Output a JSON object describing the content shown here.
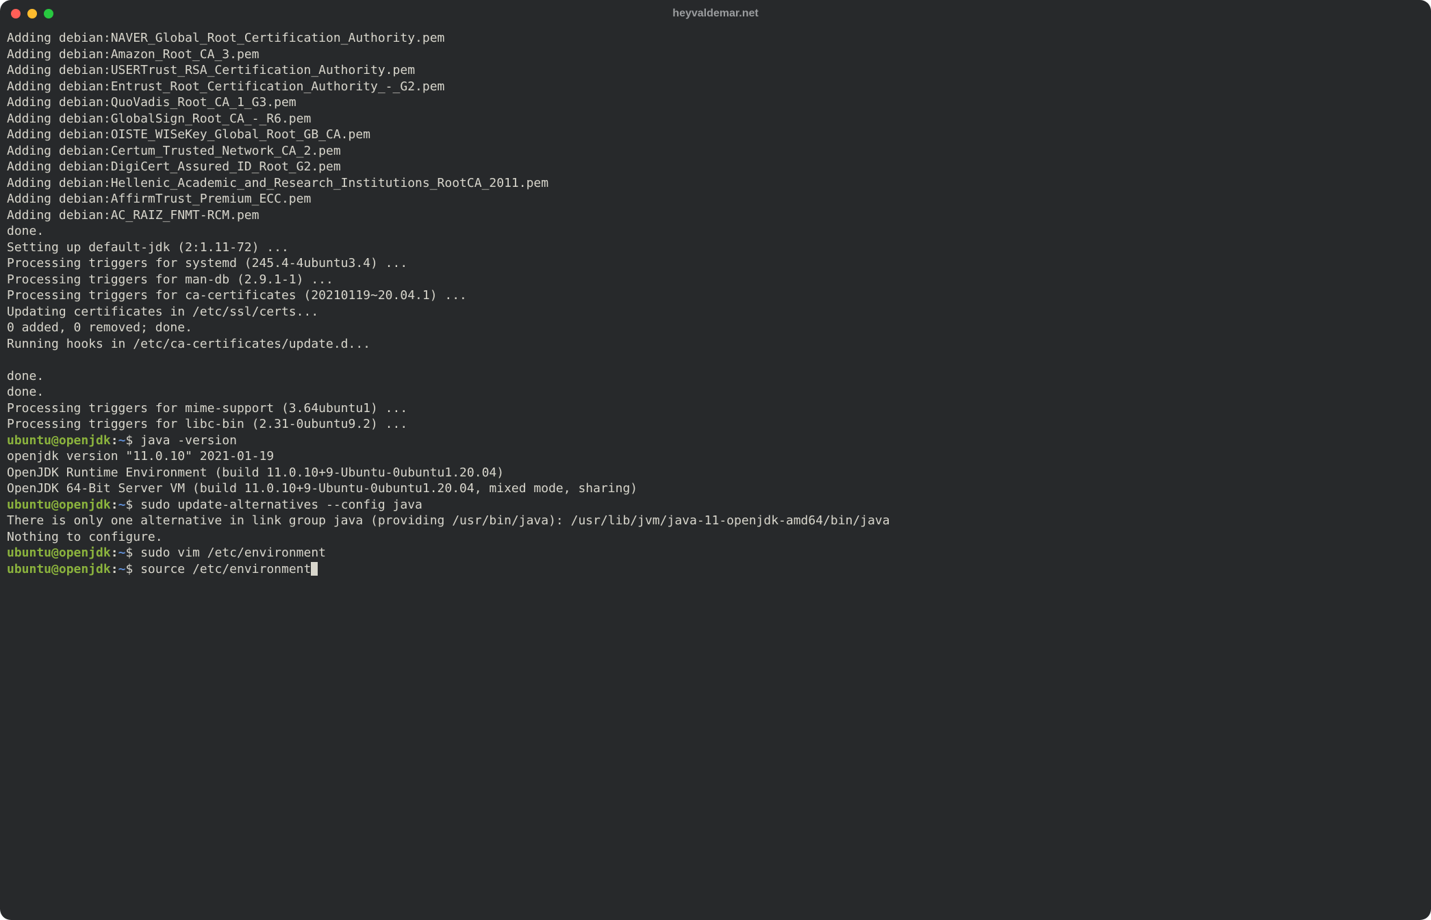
{
  "window": {
    "title": "heyvaldemar.net"
  },
  "colors": {
    "bg": "#27292b",
    "fg": "#d8d6cc",
    "prompt_user": "#8bb33d",
    "prompt_path": "#5f8dd3"
  },
  "prompt": {
    "user_host": "ubuntu@openjdk",
    "colon": ":",
    "path": "~",
    "symbol": "$"
  },
  "output_lines": [
    "Adding debian:NAVER_Global_Root_Certification_Authority.pem",
    "Adding debian:Amazon_Root_CA_3.pem",
    "Adding debian:USERTrust_RSA_Certification_Authority.pem",
    "Adding debian:Entrust_Root_Certification_Authority_-_G2.pem",
    "Adding debian:QuoVadis_Root_CA_1_G3.pem",
    "Adding debian:GlobalSign_Root_CA_-_R6.pem",
    "Adding debian:OISTE_WISeKey_Global_Root_GB_CA.pem",
    "Adding debian:Certum_Trusted_Network_CA_2.pem",
    "Adding debian:DigiCert_Assured_ID_Root_G2.pem",
    "Adding debian:Hellenic_Academic_and_Research_Institutions_RootCA_2011.pem",
    "Adding debian:AffirmTrust_Premium_ECC.pem",
    "Adding debian:AC_RAIZ_FNMT-RCM.pem",
    "done.",
    "Setting up default-jdk (2:1.11-72) ...",
    "Processing triggers for systemd (245.4-4ubuntu3.4) ...",
    "Processing triggers for man-db (2.9.1-1) ...",
    "Processing triggers for ca-certificates (20210119~20.04.1) ...",
    "Updating certificates in /etc/ssl/certs...",
    "0 added, 0 removed; done.",
    "Running hooks in /etc/ca-certificates/update.d...",
    "",
    "done.",
    "done.",
    "Processing triggers for mime-support (3.64ubuntu1) ...",
    "Processing triggers for libc-bin (2.31-0ubuntu9.2) ..."
  ],
  "entries": [
    {
      "command": "java -version",
      "response": [
        "openjdk version \"11.0.10\" 2021-01-19",
        "OpenJDK Runtime Environment (build 11.0.10+9-Ubuntu-0ubuntu1.20.04)",
        "OpenJDK 64-Bit Server VM (build 11.0.10+9-Ubuntu-0ubuntu1.20.04, mixed mode, sharing)"
      ]
    },
    {
      "command": "sudo update-alternatives --config java",
      "response": [
        "There is only one alternative in link group java (providing /usr/bin/java): /usr/lib/jvm/java-11-openjdk-amd64/bin/java",
        "Nothing to configure."
      ]
    },
    {
      "command": "sudo vim /etc/environment",
      "response": []
    }
  ],
  "current_command": "source /etc/environment"
}
